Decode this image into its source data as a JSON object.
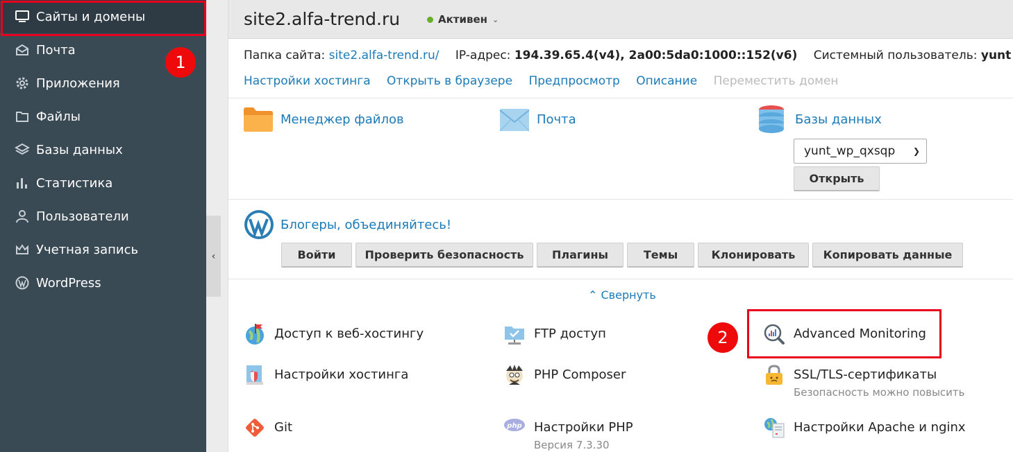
{
  "sidebar": {
    "items": [
      {
        "label": "Сайты и домены",
        "icon": "monitor-icon"
      },
      {
        "label": "Почта",
        "icon": "mail-icon"
      },
      {
        "label": "Приложения",
        "icon": "gear-icon"
      },
      {
        "label": "Файлы",
        "icon": "folder-icon"
      },
      {
        "label": "Базы данных",
        "icon": "layers-icon"
      },
      {
        "label": "Статистика",
        "icon": "bar-chart-icon"
      },
      {
        "label": "Пользователи",
        "icon": "user-icon"
      },
      {
        "label": "Учетная запись",
        "icon": "crown-icon"
      },
      {
        "label": "WordPress",
        "icon": "wordpress-icon"
      }
    ]
  },
  "annotations": {
    "badge1": "1",
    "badge2": "2"
  },
  "header": {
    "site_title": "site2.alfa-trend.ru",
    "status": "Активен"
  },
  "info": {
    "folder_label": "Папка сайта:",
    "folder_value": "site2.alfa-trend.ru/",
    "ip_label": "IP-адрес:",
    "ip_value": "194.39.65.4(v4), 2a00:5da0:1000::152(v6)",
    "sysuser_label": "Системный пользователь:",
    "sysuser_value": "yunt"
  },
  "links": {
    "hosting_settings": "Настройки хостинга",
    "open_browser": "Открыть в браузере",
    "preview": "Предпросмотр",
    "description": "Описание",
    "move_domain": "Переместить домен"
  },
  "tools": {
    "file_manager": "Менеджер файлов",
    "mail": "Почта",
    "databases": "Базы данных",
    "db_selected": "yunt_wp_qxsqp",
    "open_button": "Открыть"
  },
  "wordpress": {
    "title": "Блогеры, объединяйтесь!",
    "buttons": [
      "Войти",
      "Проверить безопасность",
      "Плагины",
      "Темы",
      "Клонировать",
      "Копировать данные"
    ]
  },
  "collapse_label": "Свернуть",
  "features": {
    "web_access": "Доступ к веб-хостингу",
    "ftp": "FTP доступ",
    "adv_monitoring": "Advanced Monitoring",
    "hosting_settings": "Настройки хостинга",
    "php_composer": "PHP Composer",
    "ssl": "SSL/TLS-сертификаты",
    "ssl_sub": "Безопасность можно повысить",
    "git": "Git",
    "php_settings": "Настройки PHP",
    "php_sub": "Версия 7.3.30",
    "apache": "Настройки Apache и nginx"
  },
  "colors": {
    "sidebar": "#3a4a55",
    "link": "#1b7ab8",
    "highlight": "#e8001c"
  }
}
